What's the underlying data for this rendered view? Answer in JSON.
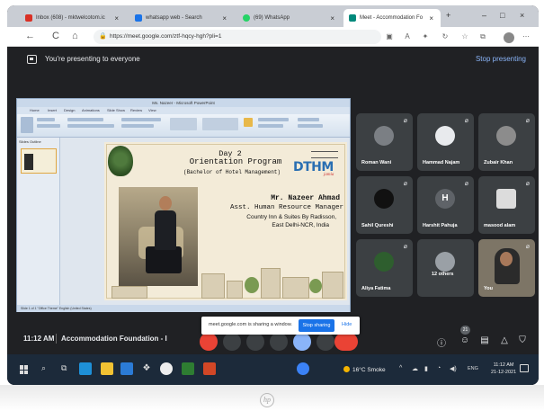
{
  "browser": {
    "tabs": [
      {
        "label": "Inbox (608) - mktwelcotom.ic",
        "favicon_color": "#d93025",
        "close": "×"
      },
      {
        "label": "whatsapp web - Search",
        "favicon_color": "#1a73e8",
        "close": "×"
      },
      {
        "label": "(69) WhatsApp",
        "favicon_color": "#25d366",
        "close": "×"
      },
      {
        "label": "Meet - Accommodation Fo",
        "favicon_color": "#00897b",
        "close": "×"
      }
    ],
    "new_tab": "+",
    "window_controls": {
      "minimize": "–",
      "maximize": "□",
      "close": "×"
    },
    "url": "https://meet.google.com/ztf-hqcy-hgh?pli=1",
    "nav": {
      "back": "←",
      "reload": "C",
      "home": "⌂"
    }
  },
  "presenting": {
    "text": "You're presenting to everyone",
    "stop": "Stop presenting"
  },
  "ppt": {
    "window_title": "Ms. Nazeer - Microsoft PowerPoint",
    "ribbon_tabs": [
      "Home",
      "Insert",
      "Design",
      "Animations",
      "Slide Show",
      "Review",
      "View"
    ],
    "panel_tabs": "Slides  Outline",
    "status": "Slide 1 of 1   \"Office Theme\"   English (United States)"
  },
  "slide": {
    "day": "Day 2",
    "program": "Orientation Program",
    "subtitle": "(Bachelor of Hotel Management)",
    "logo": "DTHM",
    "logo_tagline": "jamia",
    "speaker": "Mr. Nazeer Ahmad",
    "role": "Asst. Human Resource Manager",
    "hotel": "Country Inn & Suites By Radisson,",
    "city": "East Delhi-NCR, India"
  },
  "participants": [
    {
      "name": "Roman Wani",
      "avatar": "",
      "muted": true
    },
    {
      "name": "Hammad Najam",
      "avatar": "",
      "muted": true
    },
    {
      "name": "Zubair Khan",
      "avatar": "",
      "muted": true
    },
    {
      "name": "Sahil Qureshi",
      "avatar": "",
      "muted": true
    },
    {
      "name": "Harshit Pahuja",
      "avatar": "H",
      "muted": true
    },
    {
      "name": "masood alam",
      "avatar": "",
      "muted": true
    },
    {
      "name": "Aliya Fatima",
      "avatar": "",
      "muted": true
    },
    {
      "name": "12 others",
      "avatar": "",
      "muted": false
    },
    {
      "name": "You",
      "avatar": "",
      "muted": true
    }
  ],
  "meetbar": {
    "time": "11:12 AM",
    "meeting": "Accommodation Foundation - I",
    "participant_count": "21",
    "accent": "#8ab4f8",
    "hangup_color": "#ea4335"
  },
  "share_notice": {
    "text": "meet.google.com is sharing a window.",
    "stop": "Stop sharing",
    "hide": "Hide"
  },
  "taskbar": {
    "weather": "16°C Smoke",
    "lang": "ENG",
    "time": "11:12 AM",
    "date": "21-12-2021",
    "tray_caret": "^"
  }
}
